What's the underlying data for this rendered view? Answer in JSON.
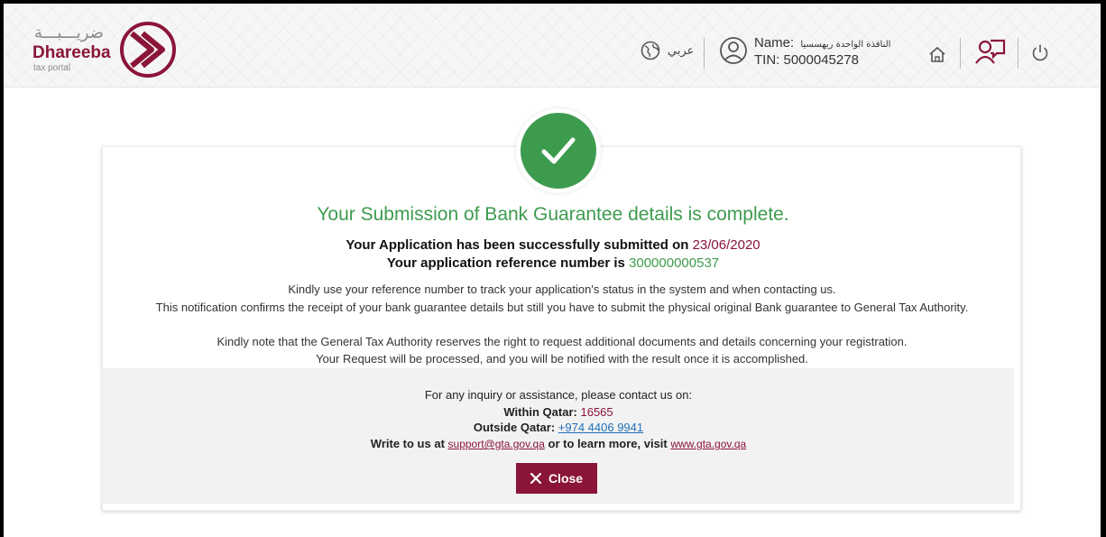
{
  "brand": {
    "arabic_name": "ضريـــبـــة",
    "name": "Dhareeba",
    "subtitle": "tax portal",
    "accent": "#8a1538",
    "success": "#3d9b4e"
  },
  "header": {
    "language_label": "عربي",
    "user_name_label": "Name:",
    "user_name_value": "النافذة الواحدة ريهسسيا",
    "tin": "TIN: 5000045278",
    "icons": [
      "globe-icon",
      "user-icon",
      "home-icon",
      "switch-profile-icon",
      "power-icon"
    ]
  },
  "confirmation": {
    "title": "Your Submission of Bank Guarantee details is complete.",
    "submitted_label": "Your Application has been successfully submitted on",
    "submitted_date": "23/06/2020",
    "reference_label": "Your application reference number is",
    "reference_number": "300000000537",
    "messages": [
      "Kindly use your reference number to track your application's status in the system and when contacting us.",
      "This notification confirms the receipt of your bank guarantee details but still you have to submit the physical original Bank guarantee to General Tax Authority.",
      "Kindly note that the General Tax Authority reserves the right to request additional documents and details concerning your registration.",
      "Your Request will be processed, and you will be notified with the result once it is accomplished."
    ]
  },
  "contact": {
    "heading": "For any inquiry or assistance, please contact us on:",
    "within_label": "Within Qatar:",
    "within_value": "16565",
    "outside_label": "Outside Qatar:",
    "outside_value": "+974 4406 9941",
    "write_label": "Write to us at",
    "email": "support@gta.gov.qa",
    "learn_more_label": "or to learn more, visit",
    "website": "www.gta.gov.qa"
  },
  "actions": {
    "close_label": "Close"
  }
}
